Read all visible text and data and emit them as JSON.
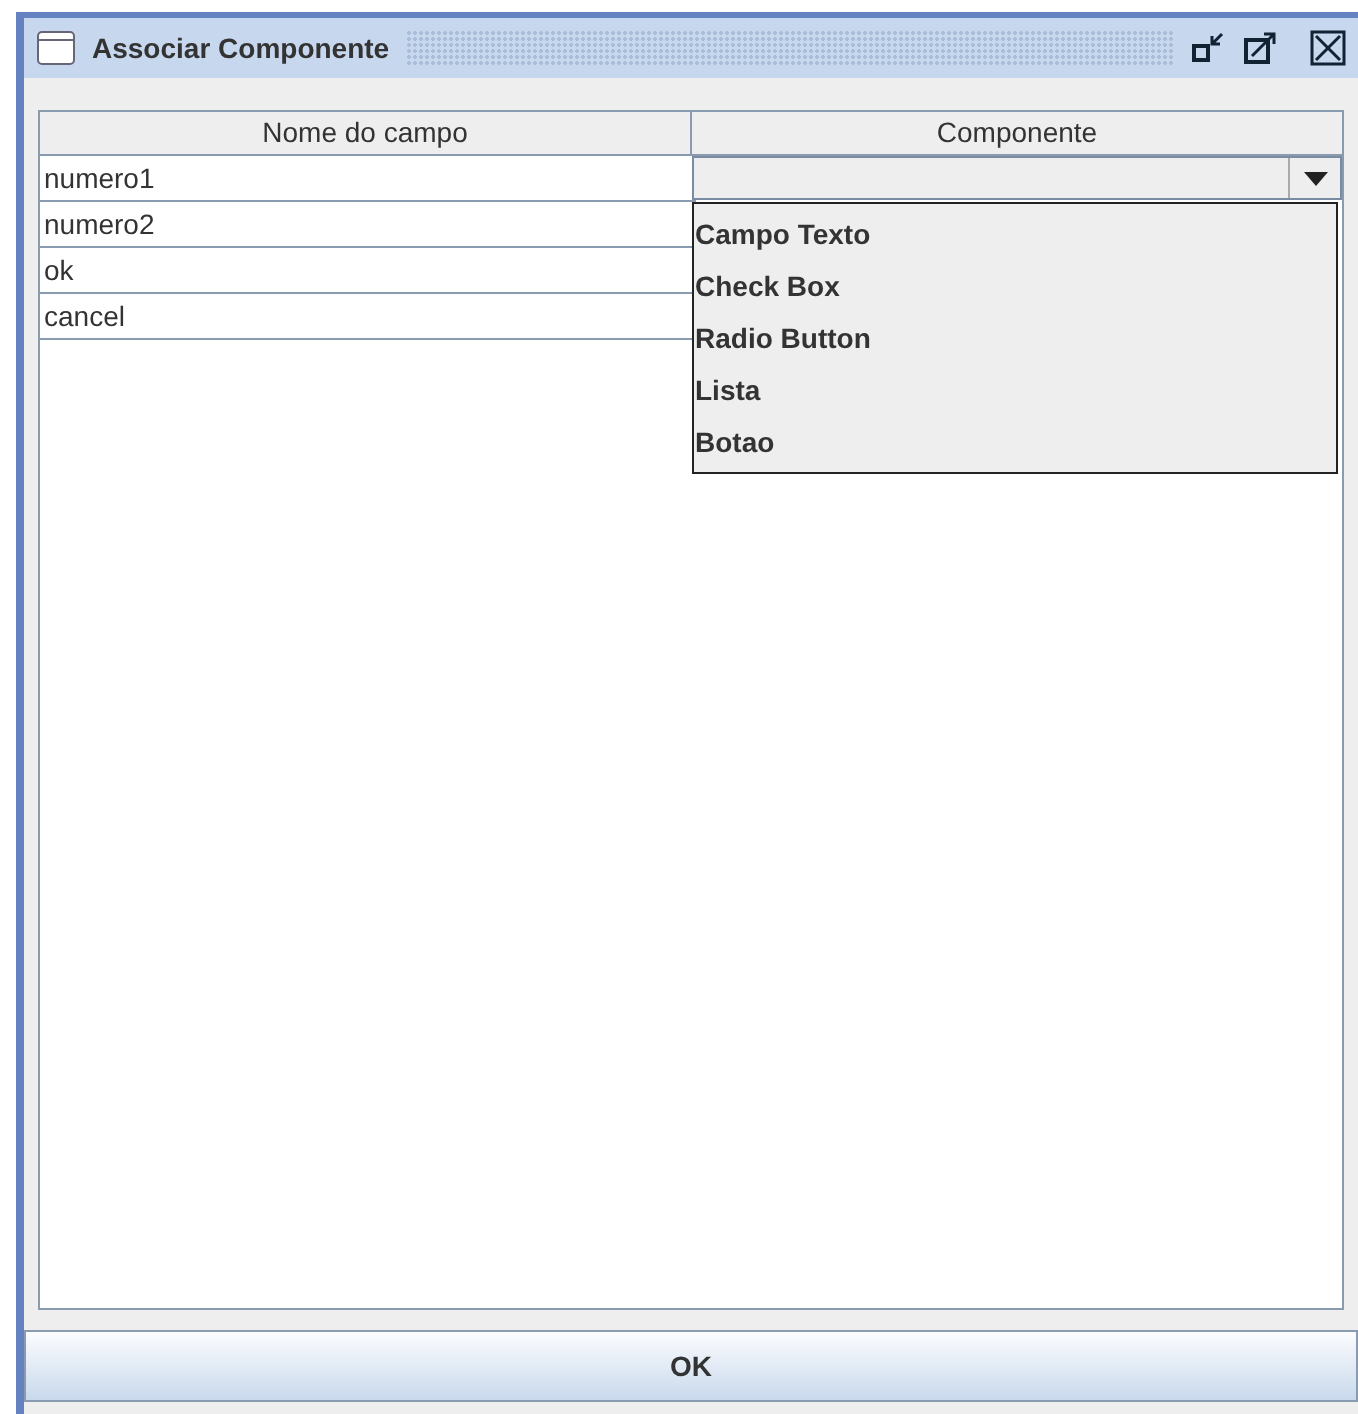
{
  "window": {
    "title": "Associar Componente"
  },
  "table": {
    "columns": [
      "Nome do campo",
      "Componente"
    ],
    "rows": [
      {
        "name": "numero1"
      },
      {
        "name": "numero2"
      },
      {
        "name": "ok"
      },
      {
        "name": "cancel"
      }
    ]
  },
  "combo": {
    "expanded": true,
    "options": [
      {
        "label": "Campo Texto",
        "selected": false
      },
      {
        "label": "Check Box",
        "selected": false
      },
      {
        "label": "Radio Button",
        "selected": false
      },
      {
        "label": "Lista",
        "selected": false
      },
      {
        "label": "Botao",
        "selected": false
      }
    ]
  },
  "buttons": [
    "OK"
  ]
}
